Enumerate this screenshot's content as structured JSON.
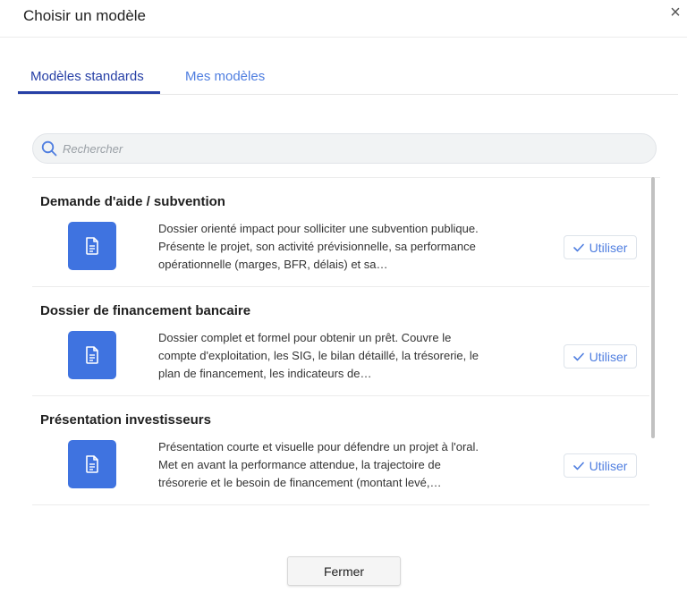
{
  "dialog": {
    "title": "Choisir un modèle",
    "close_symbol": "×"
  },
  "tabs": [
    {
      "label": "Modèles standards",
      "active": true
    },
    {
      "label": "Mes modèles",
      "active": false
    }
  ],
  "search": {
    "placeholder": "Rechercher",
    "value": ""
  },
  "templates": [
    {
      "title": "Demande d'aide / subvention",
      "description": "Dossier orienté impact pour solliciter une subvention publique. Présente le projet, son activité prévisionnelle, sa performance opérationnelle (marges, BFR, délais) et sa…",
      "action_label": "Utiliser",
      "icon": "document-icon"
    },
    {
      "title": "Dossier de financement bancaire",
      "description": "Dossier complet et formel pour obtenir un prêt. Couvre le compte d'exploitation, les SIG, le bilan détaillé, la trésorerie, le plan de financement, les indicateurs de…",
      "action_label": "Utiliser",
      "icon": "document-icon"
    },
    {
      "title": "Présentation investisseurs",
      "description": "Présentation courte et visuelle pour défendre un projet à l'oral. Met en avant la performance attendue, la trajectoire de trésorerie et le besoin de financement (montant levé,…",
      "action_label": "Utiliser",
      "icon": "document-icon"
    }
  ],
  "footer": {
    "close_label": "Fermer"
  },
  "colors": {
    "accent_dark": "#2740a6",
    "accent": "#4f7ee0",
    "icon_tile": "#3f73e0"
  }
}
